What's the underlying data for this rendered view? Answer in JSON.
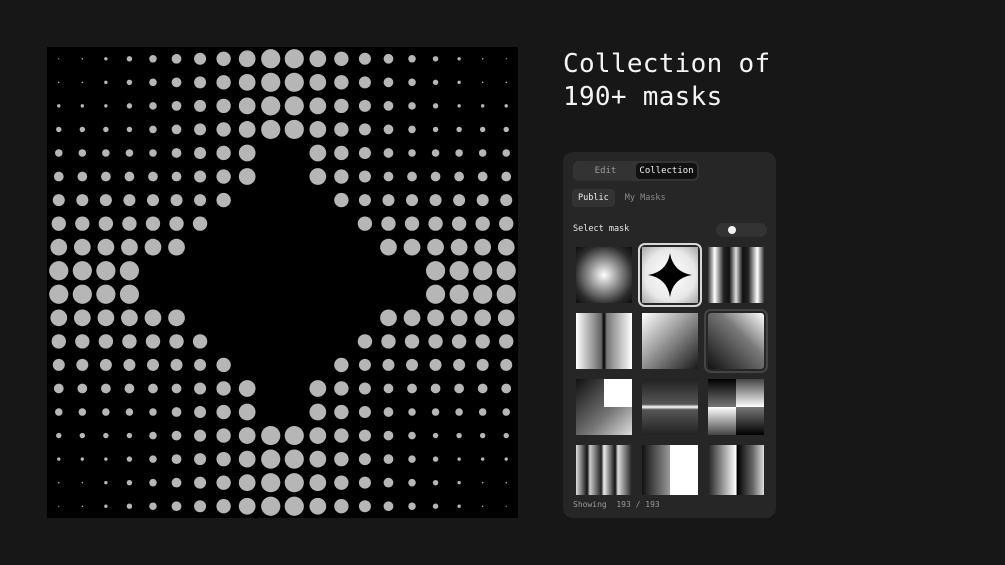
{
  "headline": {
    "line1": "Collection of",
    "line2": "190+ masks"
  },
  "preview": {
    "pattern": "halftone-dots",
    "mask": "four-point-star",
    "dot_color": "#b6b6b6",
    "background": "#000000"
  },
  "panel": {
    "tabs": [
      {
        "label": "Edit",
        "active": false
      },
      {
        "label": "Collection",
        "active": true
      }
    ],
    "subtabs": [
      {
        "label": "Public",
        "active": true
      },
      {
        "label": "My Masks",
        "active": false
      }
    ],
    "select_label": "Select mask",
    "toggle_on": false,
    "thumbnails": [
      {
        "name": "radial-gradient",
        "selected": false
      },
      {
        "name": "four-point-star",
        "selected": true
      },
      {
        "name": "vertical-cylinder-bands",
        "selected": false
      },
      {
        "name": "vertical-split-gradient",
        "selected": false
      },
      {
        "name": "diagonal-gradient",
        "selected": false
      },
      {
        "name": "diagonal-corner-gradient",
        "selected": false
      },
      {
        "name": "corner-square",
        "selected": false
      },
      {
        "name": "horizontal-bar",
        "selected": false
      },
      {
        "name": "checker-quadrants",
        "selected": false
      },
      {
        "name": "vertical-stripes",
        "selected": false
      },
      {
        "name": "vertical-gradient-halves",
        "selected": false
      },
      {
        "name": "vertical-edge-bands",
        "selected": false
      }
    ],
    "count_label": "Showing",
    "count_value": "193 / 193"
  }
}
